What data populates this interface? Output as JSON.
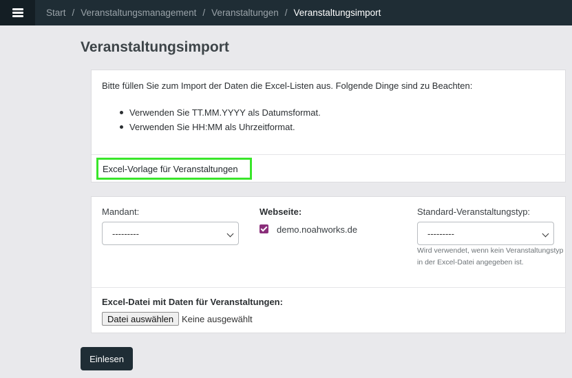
{
  "nav": {
    "menu_icon": "hamburger-icon",
    "breadcrumb": [
      "Start",
      "Veranstaltungsmanagement",
      "Veranstaltungen",
      "Veranstaltungsimport"
    ],
    "separator": "/"
  },
  "page": {
    "title": "Veranstaltungsimport"
  },
  "instructions": {
    "intro": "Bitte füllen Sie zum Import der Daten die Excel-Listen aus. Folgende Dinge sind zu Beachten:",
    "items": [
      "Verwenden Sie TT.MM.YYYY als Datumsformat.",
      "Verwenden Sie HH:MM als Uhrzeitformat."
    ],
    "template_link": "Excel-Vorlage für Veranstaltungen"
  },
  "form": {
    "mandant_label": "Mandant:",
    "mandant_value": "---------",
    "website_label": "Webseite:",
    "website_option": "demo.noahworks.de",
    "website_checked": true,
    "type_label": "Standard-Veranstaltungstyp:",
    "type_value": "---------",
    "type_help": "Wird verwendet, wenn kein Veranstaltungstyp in der Excel-Datei angegeben ist.",
    "file_label": "Excel-Datei mit Daten für Veranstaltungen:",
    "file_button": "Datei auswählen",
    "file_status": "Keine ausgewählt",
    "submit": "Einlesen"
  },
  "colors": {
    "topbar": "#1f2d35",
    "highlight": "#39e62a",
    "checkbox": "#8a2e7a"
  }
}
